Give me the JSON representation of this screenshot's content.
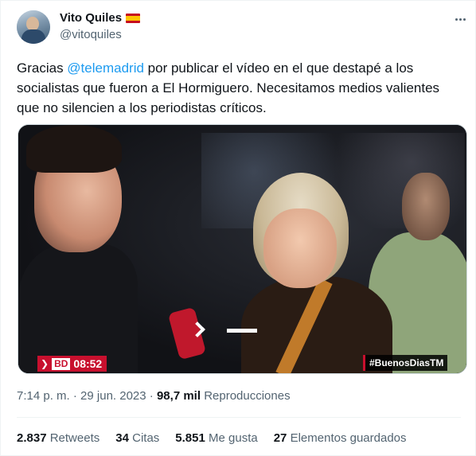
{
  "author": {
    "name": "Vito Quiles",
    "handle": "@vitoquiles",
    "flag_icon": "spain-flag-icon"
  },
  "tweet": {
    "text_before": "Gracias ",
    "mention": "@telemadrid",
    "text_after": " por publicar el vídeo en el que destapé a los socialistas que fueron a El Hormiguero. Necesitamos medios valientes que no silencien a los periodistas críticos."
  },
  "video": {
    "channel_badge": "BD",
    "time": "08:52",
    "hashtag": "#BuenosDiasTM"
  },
  "meta": {
    "time": "7:14 p. m.",
    "separator": "·",
    "date": "29 jun. 2023",
    "views_value": "98,7 mil",
    "views_label": "Reproducciones"
  },
  "stats": [
    {
      "value": "2.837",
      "label": "Retweets"
    },
    {
      "value": "34",
      "label": "Citas"
    },
    {
      "value": "5.851",
      "label": "Me gusta"
    },
    {
      "value": "27",
      "label": "Elementos guardados"
    }
  ],
  "colors": {
    "link": "#1d9bf0",
    "secondary_text": "#536471",
    "badge_red": "#c8102e"
  }
}
